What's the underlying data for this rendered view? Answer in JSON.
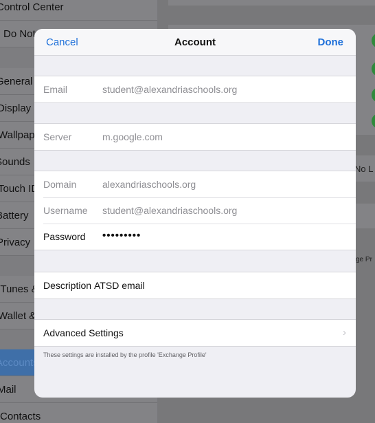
{
  "background": {
    "sidebar_items": [
      {
        "label": "Control Center"
      },
      {
        "label": "Do Not Disturb"
      },
      {
        "label": "General"
      },
      {
        "label": "Display & Brightness"
      },
      {
        "label": "Wallpaper"
      },
      {
        "label": "Sounds"
      },
      {
        "label": "Touch ID & Passcode"
      },
      {
        "label": "Battery"
      },
      {
        "label": "Privacy"
      },
      {
        "label": "iTunes & App Store"
      },
      {
        "label": "Wallet & Apple Pay"
      },
      {
        "label": "Accounts"
      },
      {
        "label": "Mail"
      },
      {
        "label": "Contacts"
      }
    ],
    "main_text_no": "No L",
    "main_text_profile": "ge Pr"
  },
  "sheet": {
    "nav": {
      "cancel_label": "Cancel",
      "title": "Account",
      "done_label": "Done"
    },
    "email": {
      "label": "Email",
      "value": "student@alexandriaschools.org"
    },
    "server": {
      "label": "Server",
      "value": "m.google.com"
    },
    "domain": {
      "label": "Domain",
      "value": "alexandriaschools.org"
    },
    "username": {
      "label": "Username",
      "value": "student@alexandriaschools.org"
    },
    "password": {
      "label": "Password",
      "value": "•••••••••"
    },
    "description": {
      "label": "Description",
      "value": "ATSD email"
    },
    "advanced": {
      "label": "Advanced Settings",
      "chevron_icon": "chevron-right-icon"
    },
    "footnote": "These settings are installed by the profile 'Exchange Profile'"
  },
  "colors": {
    "accent": "#1d6fd9",
    "toggle_on": "#2f8a3b"
  }
}
